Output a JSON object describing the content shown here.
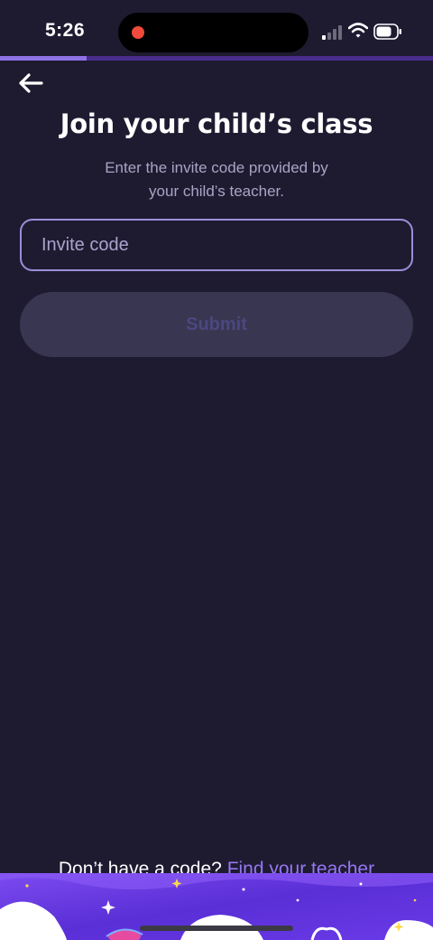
{
  "status_bar": {
    "time": "5:26"
  },
  "progress": {
    "value_fraction": 0.2
  },
  "header": {
    "back_icon": "arrow-left-icon"
  },
  "title": "Join your child’s class",
  "subtitle_line1": "Enter the invite code provided by",
  "subtitle_line2": "your child’s teacher.",
  "invite_input": {
    "placeholder": "Invite code",
    "value": ""
  },
  "submit_button": {
    "label": "Submit"
  },
  "footer": {
    "prompt_text": "Don’t have a code?",
    "link_text": "Find your teacher"
  },
  "colors": {
    "background": "#1e1b31",
    "accent": "#9677f2",
    "input_border": "#9b8fd9",
    "disabled_button": "#393651"
  }
}
